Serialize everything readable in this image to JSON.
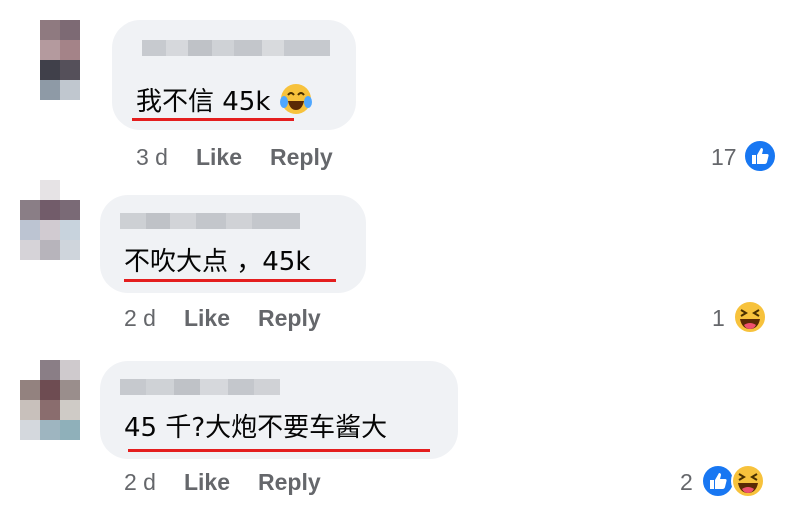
{
  "comments": [
    {
      "text": "我不信 45k",
      "emoji": "joy-icon",
      "time": "3 d",
      "like": "Like",
      "reply": "Reply",
      "count": "17",
      "reactions": [
        "like"
      ]
    },
    {
      "text": "不吹大点 ，45k",
      "time": "2 d",
      "like": "Like",
      "reply": "Reply",
      "count": "1",
      "reactions": [
        "haha"
      ]
    },
    {
      "text": "45 千?大炮不要车酱大",
      "time": "2 d",
      "like": "Like",
      "reply": "Reply",
      "count": "2",
      "reactions": [
        "like",
        "haha"
      ]
    }
  ],
  "colors": {
    "bubble": "#f0f2f5",
    "underline": "#e41e1e",
    "like": "#1877f2",
    "haha": "#f7c23c",
    "meta": "#65676b"
  }
}
